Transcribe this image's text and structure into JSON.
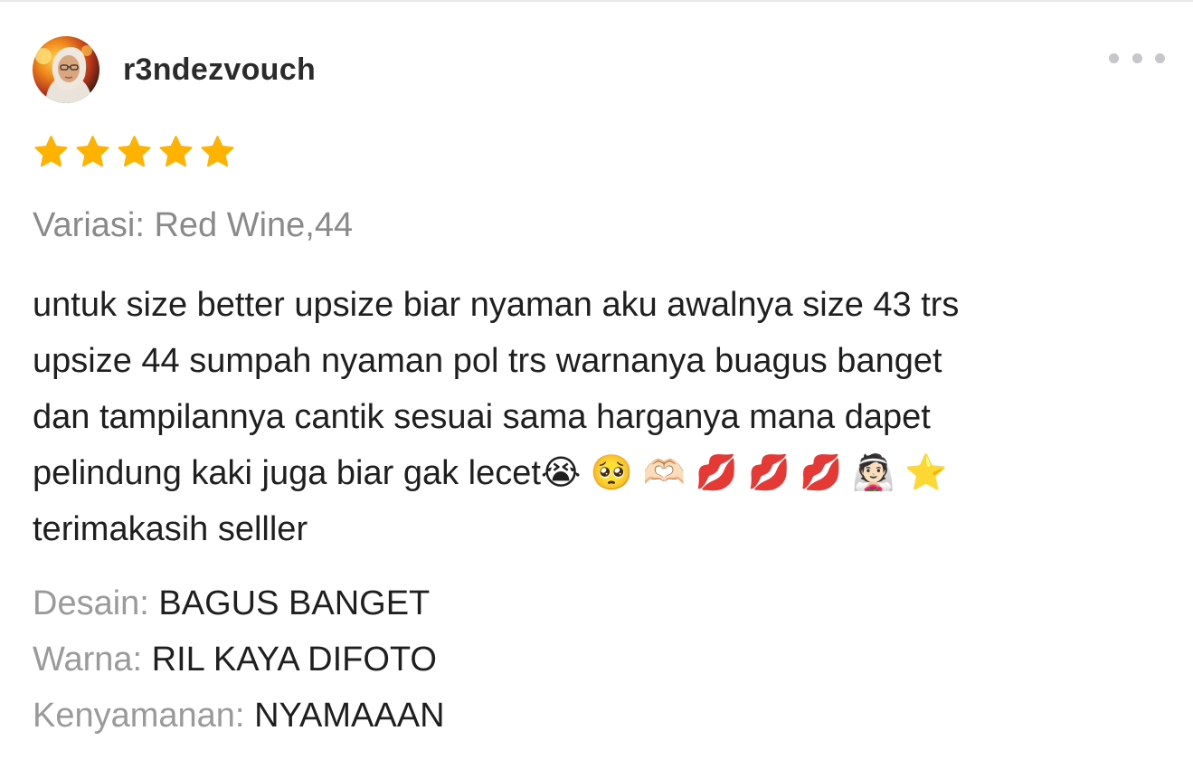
{
  "review": {
    "username": "r3ndezvouch",
    "avatar_icon": "user-avatar-photo",
    "more_icon": "more-horizontal-icon",
    "rating": 5,
    "star_color": "#ffb300",
    "variant": "Variasi: Red Wine,44",
    "text_lines": [
      "untuk size better upsize biar nyaman aku awalnya size 43 trs",
      "upsize 44 sumpah nyaman pol trs warnanya buagus banget",
      "dan tampilannya cantik sesuai sama harganya mana dapet",
      "pelindung kaki juga biar gak lecet😭 🥺 🫶🏻 💋 💋 💋 👰🏻 ⭐️",
      "terimakasih selller"
    ],
    "attributes": [
      {
        "label": "Desain:",
        "value": "BAGUS BANGET"
      },
      {
        "label": "Warna:",
        "value": "RIL KAYA DIFOTO"
      },
      {
        "label": "Kenyamanan:",
        "value": "NYAMAAAN"
      }
    ]
  }
}
